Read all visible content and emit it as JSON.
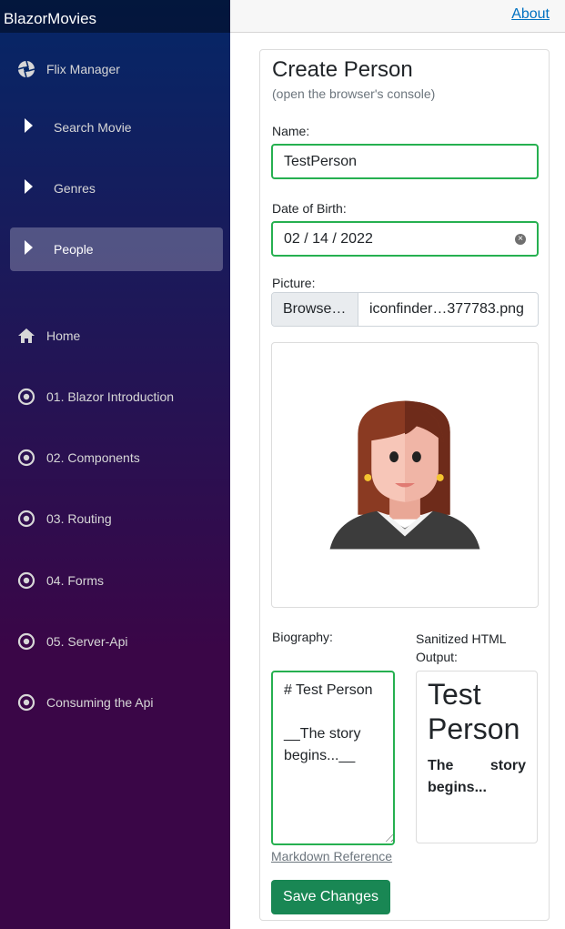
{
  "sidebar": {
    "brand": "BlazorMovies",
    "items": [
      {
        "label": "Flix Manager",
        "icon": "aperture-icon"
      },
      {
        "label": "Search Movie",
        "icon": "caret-right-icon"
      },
      {
        "label": "Genres",
        "icon": "caret-right-icon"
      },
      {
        "label": "People",
        "icon": "caret-right-icon",
        "active": true
      },
      {
        "label": "Home",
        "icon": "home-icon"
      },
      {
        "label": "01. Blazor Introduction",
        "icon": "target-icon"
      },
      {
        "label": "02. Components",
        "icon": "target-icon"
      },
      {
        "label": "03. Routing",
        "icon": "target-icon"
      },
      {
        "label": "04. Forms",
        "icon": "target-icon"
      },
      {
        "label": "05. Server-Api",
        "icon": "target-icon"
      },
      {
        "label": "Consuming the Api",
        "icon": "target-icon"
      }
    ]
  },
  "topbar": {
    "about": "About"
  },
  "form": {
    "title": "Create Person",
    "subtitle": "(open the browser's console)",
    "name_label": "Name:",
    "name_value": "TestPerson",
    "dob_label": "Date of Birth:",
    "dob_value": "02 / 14 / 2022",
    "picture_label": "Picture:",
    "browse_label": "Browse…",
    "file_name": "iconfinder…377783.png",
    "bio_label": "Biography:",
    "bio_value": "# Test Person\n\n__The story begins...__",
    "output_label": "Sanitized HTML Output:",
    "output_heading": "Test Person",
    "output_paragraph": "The story begins...",
    "markdown_link": "Markdown Reference",
    "save_label": "Save Changes"
  },
  "colors": {
    "accent_green": "#198754",
    "valid_border": "#26b050",
    "link": "#0071c1"
  }
}
